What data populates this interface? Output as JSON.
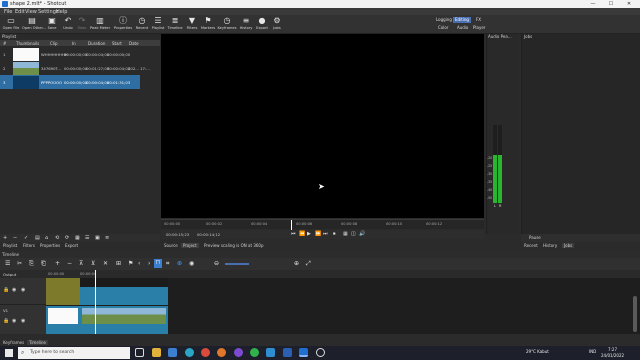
{
  "app": {
    "title": "shape 2.mlt* - Shotcut",
    "window_controls": [
      "—",
      "☐",
      "✕"
    ]
  },
  "menu": [
    "File",
    "Edit",
    "View",
    "Settings",
    "Help"
  ],
  "toolbar": [
    {
      "label": "Open File",
      "icon": "folder-icon"
    },
    {
      "label": "Open Other...",
      "icon": "open-other-icon"
    },
    {
      "label": "Save",
      "icon": "save-icon"
    },
    {
      "label": "Undo",
      "icon": "undo-icon"
    },
    {
      "label": "Redo",
      "icon": "redo-icon"
    },
    {
      "label": "Peak Meter",
      "icon": "peak-meter-icon"
    },
    {
      "label": "Properties",
      "icon": "properties-icon"
    },
    {
      "label": "Recent",
      "icon": "clock-icon"
    },
    {
      "label": "Playlist",
      "icon": "playlist-icon"
    },
    {
      "label": "Timeline",
      "icon": "timeline-icon"
    },
    {
      "label": "Filters",
      "icon": "filter-icon"
    },
    {
      "label": "Markers",
      "icon": "marker-icon"
    },
    {
      "label": "Keyframes",
      "icon": "keyframes-icon"
    },
    {
      "label": "History",
      "icon": "history-icon"
    },
    {
      "label": "Export",
      "icon": "export-icon"
    },
    {
      "label": "Jobs",
      "icon": "jobs-icon"
    }
  ],
  "modes": {
    "row1": [
      "Logging",
      "Editing",
      "FX"
    ],
    "row1_selected": "Editing",
    "row2": [
      "Color",
      "Audio",
      "Player"
    ]
  },
  "playlist": {
    "title": "Playlist",
    "columns": [
      "#",
      "Thumbnails",
      "Clip",
      "In",
      "Duration",
      "Start",
      "Date"
    ],
    "rows": [
      {
        "num": "1",
        "clip": "WHHHHHHHH",
        "in": "00:00:00;00",
        "duration": "00:00:04;00",
        "start": "00:00:00;00",
        "date": ""
      },
      {
        "num": "2",
        "clip": "347690T...",
        "in": "00:00:00;00",
        "duration": "00:01:27;03",
        "start": "00:00:04;00",
        "date": "202... 17:..."
      },
      {
        "num": "3",
        "clip": "PPPPOOOO",
        "in": "00:00:00;00",
        "duration": "00:00:04;00",
        "start": "00:01:31;03",
        "date": ""
      }
    ],
    "buttons": [
      "+",
      "−",
      "✓",
      "▤",
      "⌂",
      "⟲",
      "⟳",
      "▦",
      "☰",
      "▣",
      "≡"
    ]
  },
  "viewer": {
    "ruler_labels": [
      "00:00:00",
      "00:00:02",
      "00:00:04",
      "00:00:06",
      "00:00:08",
      "00:00:10",
      "00:00:12"
    ],
    "current_time": "00:00:15;23",
    "total_time": "00:00:14;12",
    "transport": [
      "⏮",
      "⏪",
      "▶",
      "⏩",
      "⏭",
      "⏹",
      "▦",
      "◫",
      "🔊"
    ],
    "tabs": [
      "Source",
      "Project"
    ],
    "notice": "Preview scaling is ON at 360p"
  },
  "audio_peak": {
    "title": "Audio Pea...",
    "scale": [
      "-20",
      "-25",
      "-30",
      "-35",
      "-40",
      "-50"
    ],
    "channel_labels": [
      "L",
      "R"
    ],
    "left_level": 0.62,
    "right_level": 0.62
  },
  "jobs": {
    "title": "Jobs"
  },
  "left_bottom_tabs": [
    "Playlist",
    "Filters",
    "Properties",
    "Export"
  ],
  "right_bottom_tabs": [
    "Recent",
    "History",
    "Jobs"
  ],
  "right_bottom_button": "Pause",
  "timeline": {
    "title": "Timeline",
    "ruler_labels": [
      "00:00:00",
      "00:00:04"
    ],
    "tracks": [
      {
        "name": "Output"
      },
      {
        "name": "V2"
      },
      {
        "name": "V1"
      }
    ],
    "toolbar_icons": [
      "☰",
      "✂",
      "⎘",
      "⎗",
      "+",
      "−",
      "⊼",
      "⊻",
      "✕",
      "⊞",
      "⚑",
      "‹",
      "›",
      "⊓",
      "⌗",
      "⊛",
      "◉",
      "⊖",
      "⊕",
      "⤢"
    ]
  },
  "bottom_tabs": [
    "Keyframes",
    "Timeline"
  ],
  "taskbar": {
    "search_placeholder": "Type here to search",
    "weather": "29°C Kabut",
    "lang": "IND",
    "time": "7:27",
    "date": "24/01/2022"
  },
  "colors": {
    "accent": "#4a6fb0",
    "playlist_selected": "#2f6ea3",
    "meter_green": "#29b52d",
    "clip_olive": "#7d7a2c",
    "clip_teal": "#2a7fa8"
  }
}
